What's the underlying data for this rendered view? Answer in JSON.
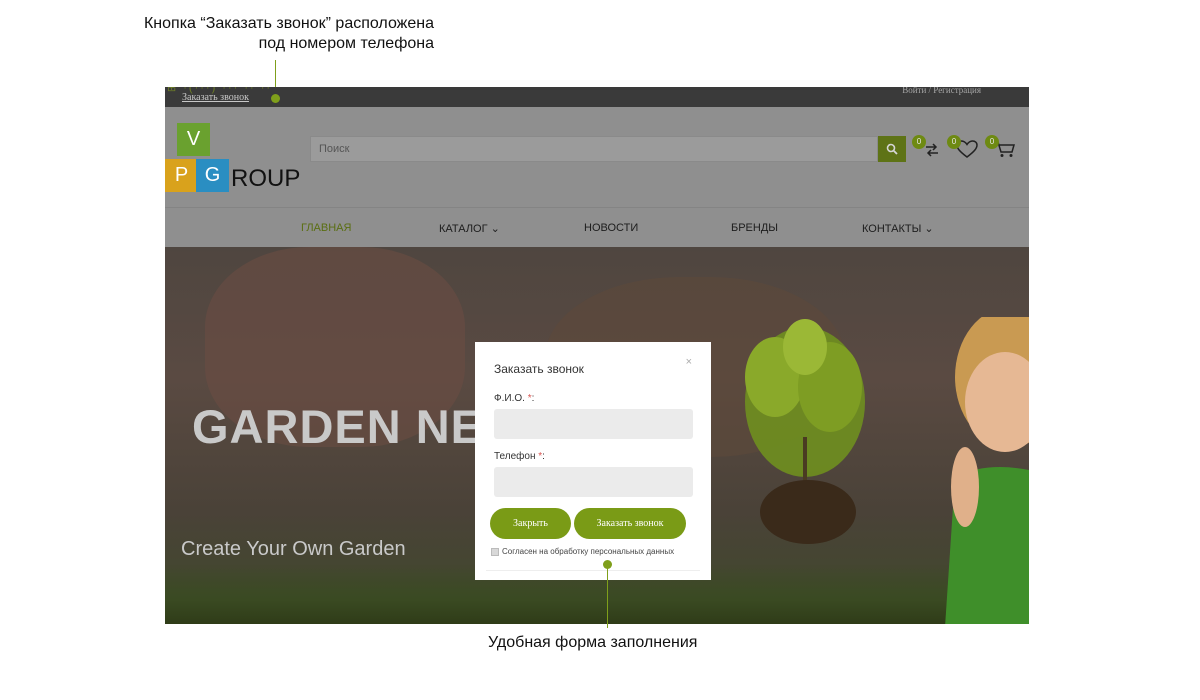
{
  "annotations": {
    "top_line1": "Кнопка “Заказать звонок” расположена",
    "top_line2": "под номером телефона",
    "bottom": "Удобная форма заполнения"
  },
  "topbar": {
    "callback_link": "Заказать звонок",
    "login": "Войти / Регистрация"
  },
  "logo": {
    "v": "V",
    "p": "P",
    "g": "G",
    "rest": "ROUP"
  },
  "search": {
    "placeholder": "Поиск"
  },
  "header_icons": {
    "compare_count": "0",
    "favorites_count": "0",
    "cart_count": "0"
  },
  "nav": {
    "items": [
      "ГЛАВНАЯ",
      "КАТАЛОГ",
      "НОВОСТИ",
      "БРЕНДЫ",
      "КОНТАКТЫ"
    ]
  },
  "hero": {
    "title": "GARDEN NEW",
    "subtitle": "Create Your Own Garden"
  },
  "modal": {
    "title": "Заказать звонок",
    "close_glyph": "×",
    "name_label": "Ф.И.О. ",
    "phone_label": "Телефон ",
    "required_mark": "*",
    "label_colon": ":",
    "close_button": "Закрыть",
    "submit_button": "Заказать звонок",
    "agree_text": "Согласен на обработку персональных данных"
  },
  "colors": {
    "accent": "#7a9b16",
    "annotation": "#7f9f1b"
  }
}
